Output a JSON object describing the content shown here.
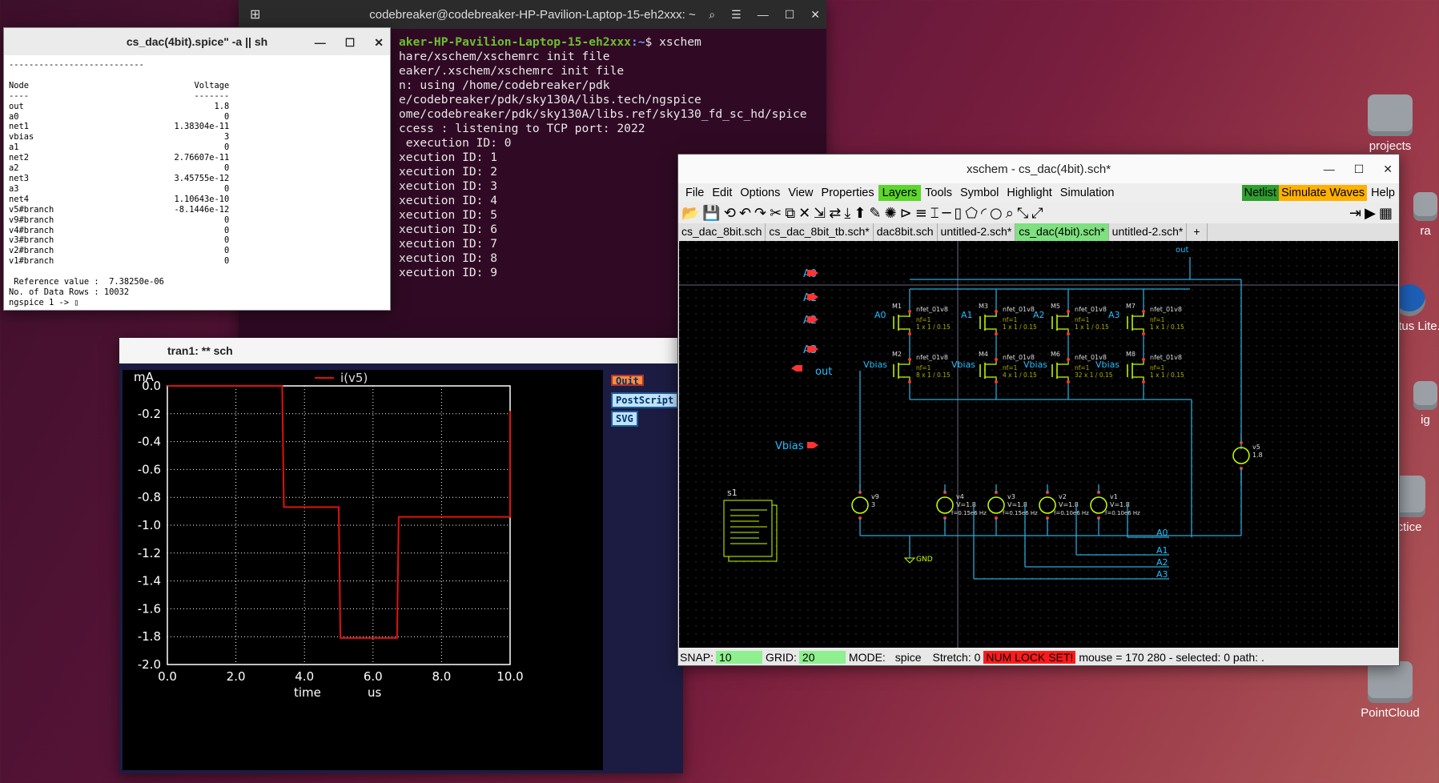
{
  "desktop": {
    "icons": [
      {
        "label": "projects"
      },
      {
        "label": "Quartus Lite..."
      },
      {
        "label": "PointCloud"
      },
      {
        "label": "ctice"
      },
      {
        "label": "ra"
      },
      {
        "label": "ig"
      }
    ]
  },
  "terminal": {
    "title": "codebreaker@codebreaker-HP-Pavilion-Laptop-15-eh2xxx: ~",
    "prompt_host": "aker-HP-Pavilion-Laptop-15-eh2xxx",
    "prompt_path": ":~",
    "prompt_cmd": "$ xschem",
    "lines": [
      "hare/xschem/xschemrc init file",
      "eaker/.xschem/xschemrc init file",
      "n: using /home/codebreaker/pdk",
      "e/codebreaker/pdk/sky130A/libs.tech/ngspice",
      "ome/codebreaker/pdk/sky130A/libs.ref/sky130_fd_sc_hd/spice",
      "ccess : listening to TCP port: 2022",
      " execution ID: 0",
      "xecution ID: 1",
      "xecution ID: 2",
      "xecution ID: 3",
      "xecution ID: 4",
      "xecution ID: 5",
      "xecution ID: 6",
      "xecution ID: 7",
      "xecution ID: 8",
      "xecution ID: 9"
    ]
  },
  "ngspice_text": {
    "title": "cs_dac(4bit).spice\" -a || sh",
    "header_rule": "---------------------------",
    "col_node": "Node",
    "col_voltage": "Voltage",
    "rule_node": "----",
    "rule_voltage": "-------",
    "rows": [
      [
        "out",
        "1.8"
      ],
      [
        "a0",
        "0"
      ],
      [
        "net1",
        "1.38304e-11"
      ],
      [
        "vbias",
        "3"
      ],
      [
        "a1",
        "0"
      ],
      [
        "net2",
        "2.76607e-11"
      ],
      [
        "a2",
        "0"
      ],
      [
        "net3",
        "3.45755e-12"
      ],
      [
        "a3",
        "0"
      ],
      [
        "net4",
        "1.10643e-10"
      ],
      [
        "v5#branch",
        "-8.1446e-12"
      ],
      [
        "v9#branch",
        "0"
      ],
      [
        "v4#branch",
        "0"
      ],
      [
        "v3#branch",
        "0"
      ],
      [
        "v2#branch",
        "0"
      ],
      [
        "v1#branch",
        "0"
      ]
    ],
    "reference": " Reference value :  7.38250e-06",
    "data_rows": "No. of Data Rows : 10032",
    "prompt": "ngspice 1 -> "
  },
  "plot": {
    "title": "tran1: ** sch",
    "buttons": {
      "quit": "Quit",
      "postscript": "PostScript",
      "svg": "SVG"
    }
  },
  "chart_data": {
    "type": "line",
    "title": "",
    "xlabel": "time",
    "xunit": "us",
    "ylabel": "mA",
    "xlim": [
      0.0,
      10.0
    ],
    "ylim": [
      -2.0,
      0.0
    ],
    "xticks": [
      "0.0",
      "2.0",
      "4.0",
      "6.0",
      "8.0",
      "10.0"
    ],
    "yticks": [
      "0.0",
      "-0.2",
      "-0.4",
      "-0.6",
      "-0.8",
      "-1.0",
      "-1.2",
      "-1.4",
      "-1.6",
      "-1.8",
      "-2.0"
    ],
    "grid": true,
    "legend": "top-center",
    "series": [
      {
        "name": "i(v5)",
        "color": "#e01010",
        "x": [
          0.0,
          3.35,
          3.4,
          5.0,
          5.05,
          6.7,
          6.75,
          10.0,
          10.0
        ],
        "y": [
          0.0,
          0.0,
          -0.87,
          -0.87,
          -1.81,
          -1.81,
          -0.94,
          -0.94,
          -0.18
        ]
      }
    ]
  },
  "xschem": {
    "title": "xschem - cs_dac(4bit).sch*",
    "menu": [
      "File",
      "Edit",
      "Options",
      "View",
      "Properties",
      "Layers",
      "Tools",
      "Symbol",
      "Highlight",
      "Simulation"
    ],
    "menu_right": {
      "netlist": "Netlist",
      "simulate": "Simulate",
      "waves": "Waves",
      "help": "Help"
    },
    "tabs": [
      "cs_dac_8bit.sch",
      "cs_dac_8bit_tb.sch*",
      "dac8bit.sch",
      "untitled-2.sch*",
      "cs_dac(4bit).sch*",
      "untitled-2.sch*",
      "+"
    ],
    "active_tab": 4,
    "status": {
      "snap_label": "SNAP:",
      "snap": "10",
      "grid_label": "GRID:",
      "grid": "20",
      "mode_label": "MODE:",
      "mode": "spice",
      "stretch": "Stretch: 0",
      "numlock": "NUM LOCK SET!",
      "mouse": "mouse = 170 280 - selected: 0 path: ."
    },
    "schematic": {
      "pins": [
        "A0",
        "A1",
        "A2",
        "A3",
        "out",
        "Vbias"
      ],
      "out_label": "out",
      "gnd": "GND",
      "sheet_label": "s1",
      "bus_labels": [
        "A0",
        "A1",
        "A2",
        "A3"
      ],
      "top_fets": [
        {
          "name": "M1",
          "gate": "A0",
          "model": "nfet_01v8",
          "nf": "nf=1",
          "size": "1 x 1 / 0.15"
        },
        {
          "name": "M3",
          "gate": "A1",
          "model": "nfet_01v8",
          "nf": "nf=1",
          "size": "1 x 1 / 0.15"
        },
        {
          "name": "M5",
          "gate": "A2",
          "model": "nfet_01v8",
          "nf": "nf=1",
          "size": "1 x 1 / 0.15"
        },
        {
          "name": "M7",
          "gate": "A3",
          "model": "nfet_01v8",
          "nf": "nf=1",
          "size": "1 x 1 / 0.15"
        }
      ],
      "bottom_fets": [
        {
          "name": "M2",
          "gate": "Vbias",
          "model": "nfet_01v8",
          "nf": "nf=1",
          "size": "8 x 1 / 0.15"
        },
        {
          "name": "M4",
          "gate": "Vbias",
          "model": "nfet_01v8",
          "nf": "nf=1",
          "size": "4 x 1 / 0.15"
        },
        {
          "name": "M6",
          "gate": "Vbias",
          "model": "nfet_01v8",
          "nf": "nf=1",
          "size": "32 x 1 / 0.15"
        },
        {
          "name": "M8",
          "gate": "",
          "model": "nfet_01v8",
          "nf": "nf=1",
          "size": "1 x 1 / 0.15"
        }
      ],
      "sources": [
        {
          "name": "v9",
          "value": "3"
        },
        {
          "name": "v4",
          "value": "V=1.8",
          "freq": "f=0.15e6 Hz"
        },
        {
          "name": "v3",
          "value": "V=1.8",
          "freq": "f=0.15e6 Hz"
        },
        {
          "name": "v2",
          "value": "V=1.8",
          "freq": "f=0.10e6 Hz"
        },
        {
          "name": "v1",
          "value": "V=1.8",
          "freq": "f=0.10e6 Hz"
        },
        {
          "name": "v5",
          "value": "1.8"
        }
      ]
    }
  },
  "colors": {
    "wire": "#2aa8d8",
    "pin": "#ff3333",
    "component": "#c8ff00",
    "label": "#22c0ff"
  }
}
